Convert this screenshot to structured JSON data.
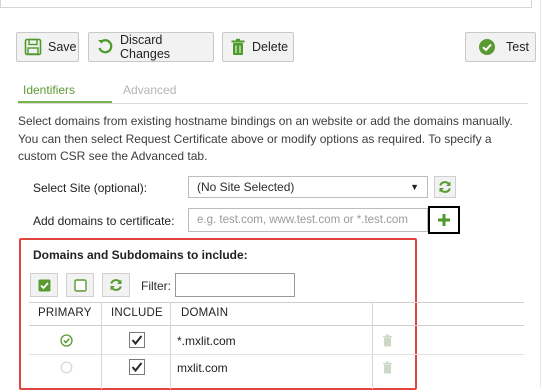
{
  "toolbar": {
    "save_label": "Save",
    "discard_label": "Discard Changes",
    "delete_label": "Delete",
    "test_label": "Test"
  },
  "tabs": [
    {
      "label": "Identifiers",
      "active": true
    },
    {
      "label": "Advanced",
      "active": false
    }
  ],
  "description": "Select domains from existing hostname bindings on an website or add the domains manually. You can then select Request Certificate above or modify options as required. To specify a custom CSR see the Advanced tab.",
  "site": {
    "label": "Select Site (optional):",
    "selected": "(No Site Selected)"
  },
  "add_domains": {
    "label": "Add domains to certificate:",
    "placeholder": "e.g. test.com, www.test.com or *.test.com"
  },
  "domains_section": {
    "title": "Domains and Subdomains to include:",
    "filter_label": "Filter:",
    "filter_value": "",
    "columns": [
      "PRIMARY",
      "INCLUDE",
      "DOMAIN"
    ],
    "rows": [
      {
        "primary": true,
        "include": true,
        "domain": "*.mxlit.com"
      },
      {
        "primary": false,
        "include": true,
        "domain": "mxlit.com"
      }
    ]
  },
  "colors": {
    "accent_green": "#5a9a32",
    "highlight_red": "#e2453f"
  }
}
